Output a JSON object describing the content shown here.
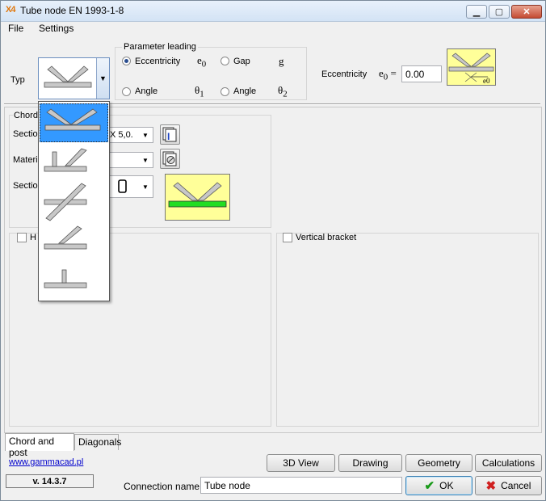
{
  "window": {
    "title": "Tube node EN 1993-1-8",
    "app_icon": "X4"
  },
  "menu": [
    "File",
    "Settings"
  ],
  "typ_label": "Typ",
  "param": {
    "group_title": "Parameter leading",
    "eccentricity_label": "Eccentricity",
    "gap_label": "Gap",
    "angle1_label": "Angle",
    "angle2_label": "Angle",
    "e0": "e",
    "e0_sub": "0",
    "g": "g",
    "theta1": "θ",
    "theta1_sub": "1",
    "theta2": "θ",
    "theta2_sub": "2",
    "selected": "Eccentricity"
  },
  "eccentricity_field": {
    "label": "Eccentricity",
    "sym": "e",
    "sym_sub": "0",
    "eq": "=",
    "value": "0.00",
    "img_label": "e0"
  },
  "chord": {
    "group_title": "Chord",
    "section_label": "Sectio",
    "section_value": "X 5,0.",
    "material_label": "Materi",
    "section2_label": "Sectio"
  },
  "horizontal_label": "H",
  "vertical_bracket_label": "Vertical bracket",
  "tabs": [
    "Chord and post",
    "Diagonals"
  ],
  "link": "www.gammacad.pl",
  "version": "v. 14.3.7",
  "buttons": {
    "view3d": "3D View",
    "drawing": "Drawing",
    "geometry": "Geometry",
    "calculations": "Calculations",
    "ok": "OK",
    "cancel": "Cancel"
  },
  "connection_name": {
    "label": "Connection name",
    "value": "Tube node"
  },
  "dropdown_options": [
    "K-joint",
    "T-joint with diagonal",
    "X-joint",
    "N-joint",
    "T-joint"
  ],
  "colors": {
    "selection": "#3399ff",
    "preview_bg": "#ffff99",
    "link": "#0000cc",
    "chord_highlight": "#22dd22"
  }
}
